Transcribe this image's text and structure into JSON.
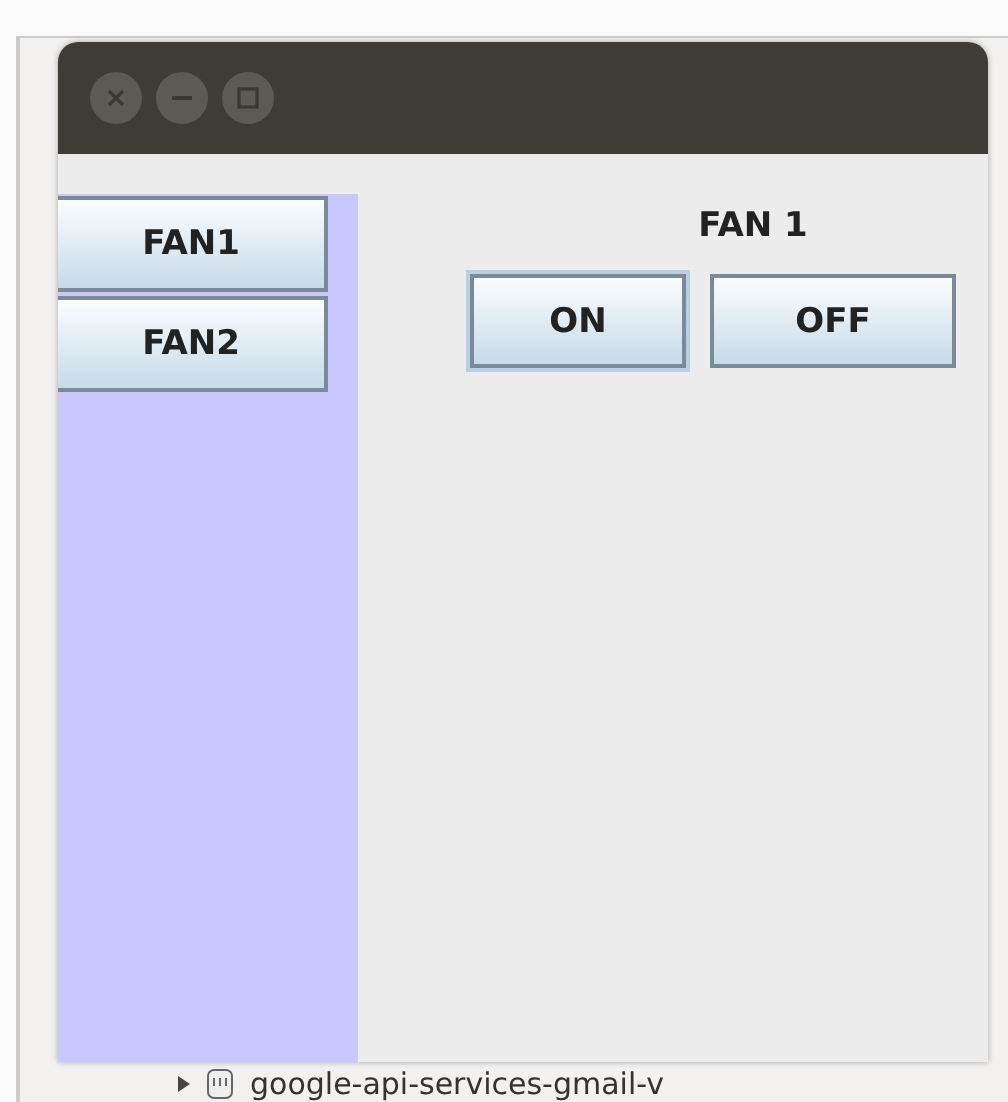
{
  "sidebar": {
    "buttons": [
      {
        "label": "FAN1"
      },
      {
        "label": "FAN2"
      }
    ]
  },
  "panel": {
    "title": "FAN 1",
    "buttons": [
      {
        "label": "ON",
        "selected": true
      },
      {
        "label": "OFF",
        "selected": false
      }
    ]
  },
  "background_tree": {
    "items": [
      {
        "label": "google-api-services-gmail-v"
      }
    ]
  }
}
